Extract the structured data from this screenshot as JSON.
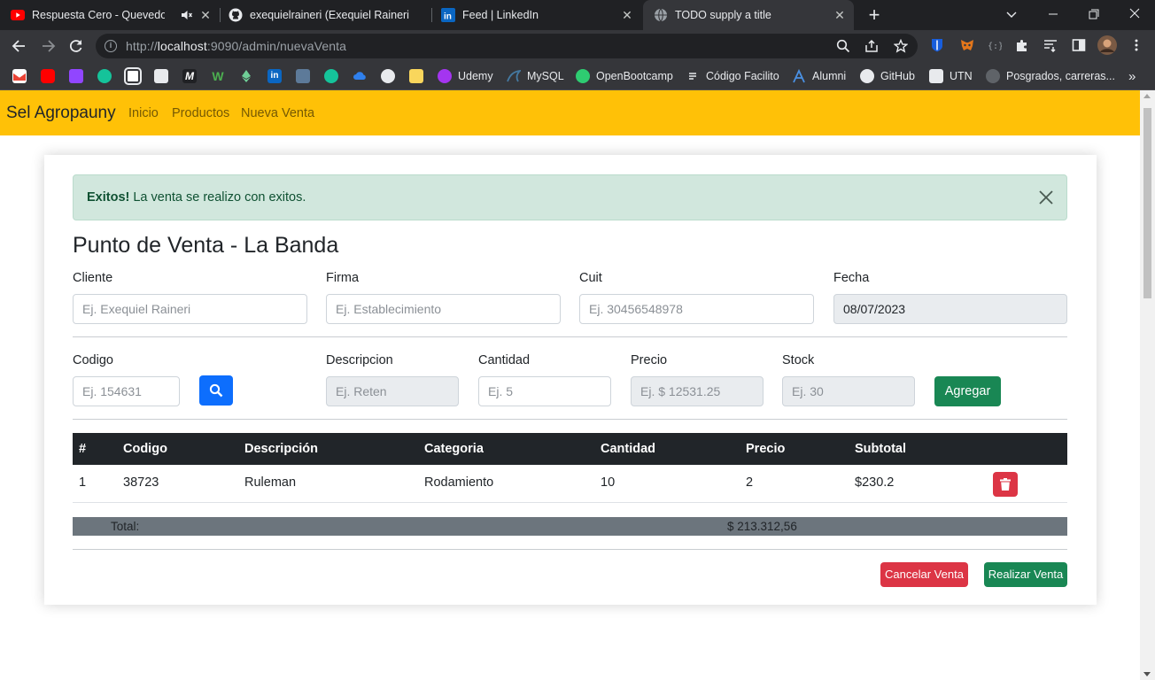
{
  "browser": {
    "tabs": [
      {
        "title": "Respuesta Cero - Quevedo, B",
        "icon": "youtube-icon"
      },
      {
        "title": "exequielraineri (Exequiel Raineri)",
        "icon": "github-icon"
      },
      {
        "title": "Feed | LinkedIn",
        "icon": "linkedin-icon"
      },
      {
        "title": "TODO supply a title",
        "icon": "globe-icon",
        "active": true
      }
    ],
    "url": {
      "scheme": "http://",
      "host": "localhost",
      "rest": ":9090/admin/nuevaVenta"
    },
    "bookmarks": [
      {
        "label": "Udemy",
        "icon": "udemy-icon"
      },
      {
        "label": "MySQL",
        "icon": "mysql-icon"
      },
      {
        "label": "OpenBootcamp",
        "icon": "openbootcamp-icon"
      },
      {
        "label": "Código Facilito",
        "icon": "codigofacilito-icon"
      },
      {
        "label": "Alumni",
        "icon": "alumni-icon"
      },
      {
        "label": "GitHub",
        "icon": "github-icon"
      },
      {
        "label": "UTN",
        "icon": "utn-icon"
      },
      {
        "label": "Posgrados, carreras...",
        "icon": "posgrados-icon"
      }
    ],
    "overflow": "»"
  },
  "navbar": {
    "brand": "Sel Agropauny",
    "links": [
      "Inicio",
      "Productos",
      "Nueva Venta"
    ],
    "bg_color": "#ffc107"
  },
  "alert": {
    "strong": "Exitos!",
    "message": "La venta se realizo con exitos."
  },
  "form": {
    "title": "Punto de Venta - La Banda",
    "cliente": {
      "label": "Cliente",
      "placeholder": "Ej. Exequiel Raineri"
    },
    "firma": {
      "label": "Firma",
      "placeholder": "Ej. Establecimiento"
    },
    "cuit": {
      "label": "Cuit",
      "placeholder": "Ej. 30456548978"
    },
    "fecha": {
      "label": "Fecha",
      "value": "08/07/2023"
    },
    "codigo": {
      "label": "Codigo",
      "placeholder": "Ej. 154631"
    },
    "descripcion": {
      "label": "Descripcion",
      "placeholder": "Ej. Reten"
    },
    "cantidad": {
      "label": "Cantidad",
      "placeholder": "Ej. 5"
    },
    "precio": {
      "label": "Precio",
      "placeholder": "Ej. $ 12531.25"
    },
    "stock": {
      "label": "Stock",
      "placeholder": "Ej. 30"
    },
    "agregar_label": "Agregar"
  },
  "table": {
    "headers": [
      "#",
      "Codigo",
      "Descripción",
      "Categoria",
      "Cantidad",
      "Precio",
      "Subtotal"
    ],
    "rows": [
      [
        "1",
        "38723",
        "Ruleman",
        "Rodamiento",
        "10",
        "2",
        "$230.2"
      ]
    ],
    "total_label": "Total:",
    "total_value": "$ 213.312,56"
  },
  "actions": {
    "cancel_label": "Cancelar Venta",
    "submit_label": "Realizar Venta"
  },
  "colors": {
    "primary": "#0d6efd",
    "success": "#198754",
    "danger": "#dc3545",
    "alert_bg": "#d1e7dd",
    "table_head": "#212529",
    "total_bar": "#6c757d"
  }
}
